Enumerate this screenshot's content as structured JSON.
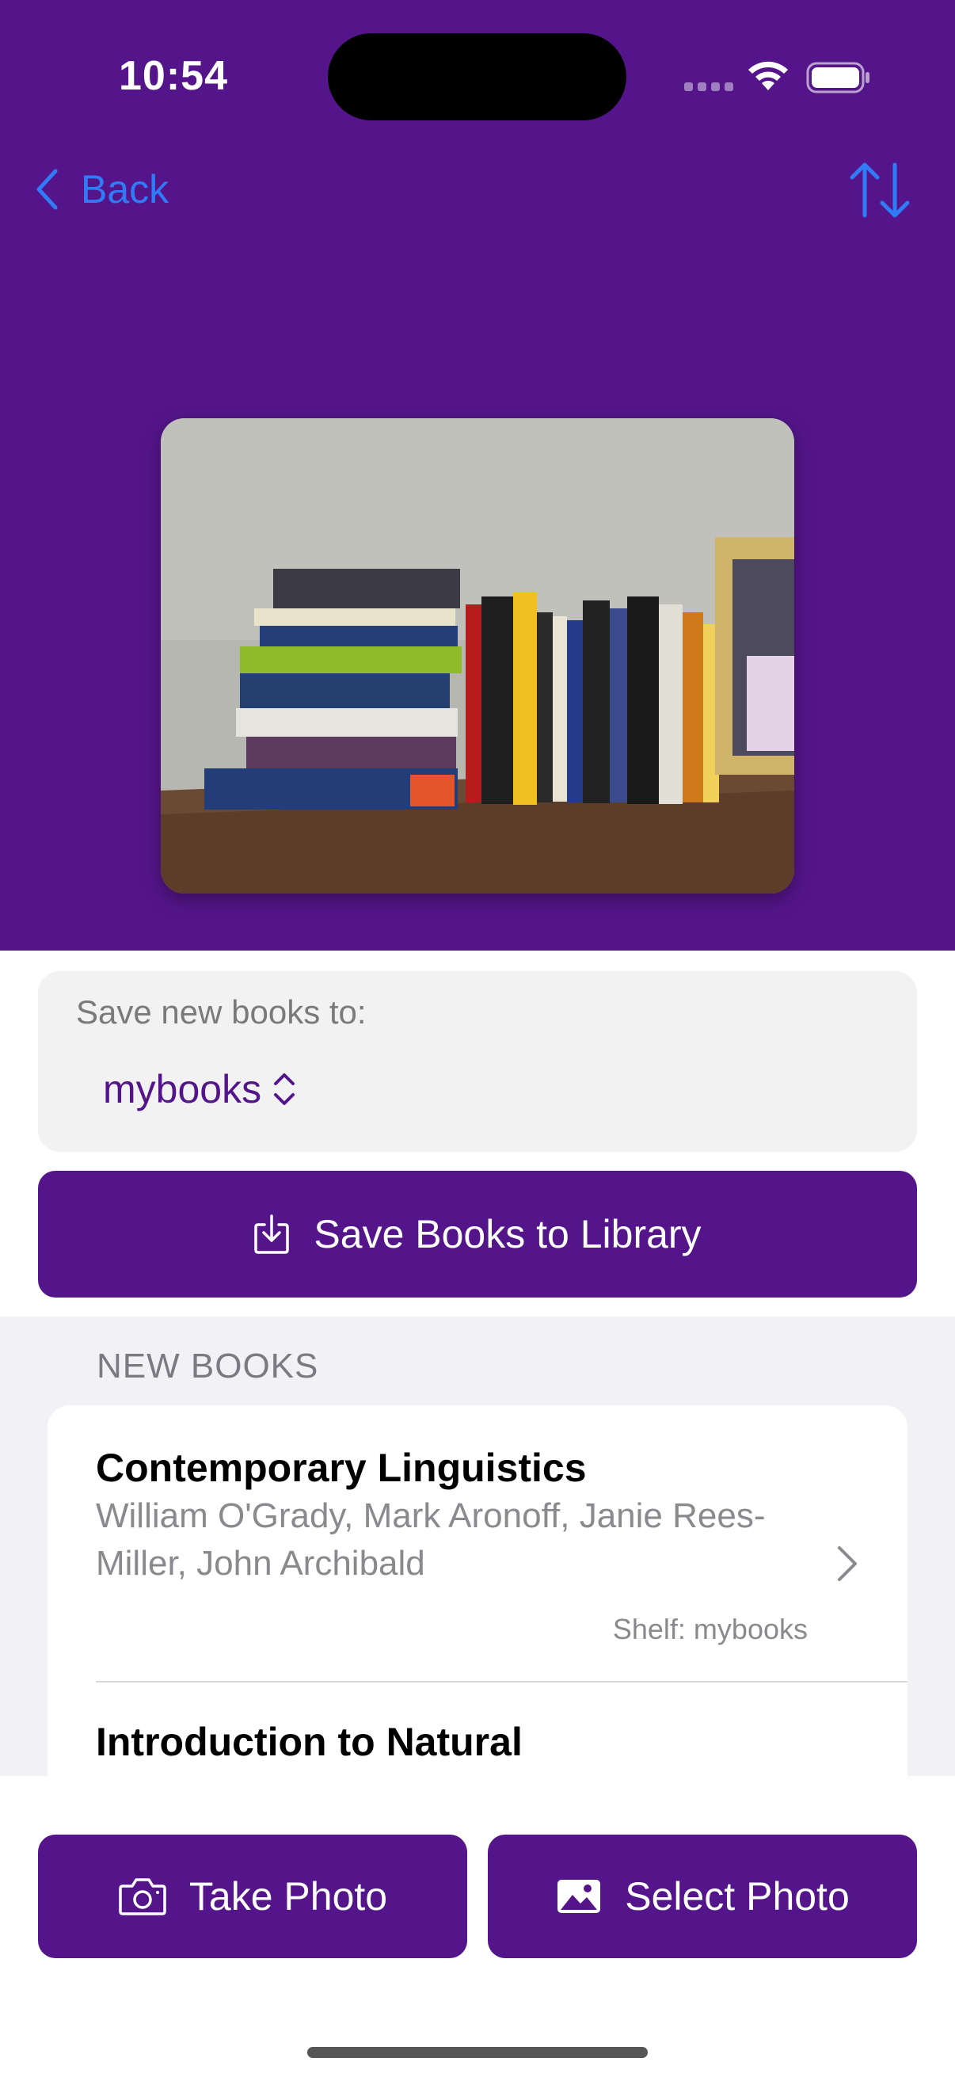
{
  "status_bar": {
    "time": "10:54"
  },
  "nav": {
    "back_label": "Back",
    "sort_icon": "sort-arrows-icon"
  },
  "photo": {
    "description_icon": "bookshelf-photo"
  },
  "save_destination": {
    "label": "Save new books to:",
    "selected_library": "mybooks"
  },
  "save_button": {
    "label": "Save Books to Library",
    "icon": "download-tray-icon"
  },
  "new_books": {
    "header": "NEW BOOKS",
    "items": [
      {
        "title": "Contemporary Linguistics",
        "authors": "William O'Grady, Mark Aronoff, Janie Rees-Miller, John Archibald",
        "shelf": "Shelf: mybooks"
      },
      {
        "title": "Introduction to Natural"
      }
    ]
  },
  "bottom_bar": {
    "take_photo_label": "Take Photo",
    "select_photo_label": "Select Photo"
  },
  "colors": {
    "primary_purple": "#55158a",
    "link_blue": "#2f7cf6",
    "secondary_text": "#8a8a8e",
    "list_background": "#f2f1f6"
  }
}
